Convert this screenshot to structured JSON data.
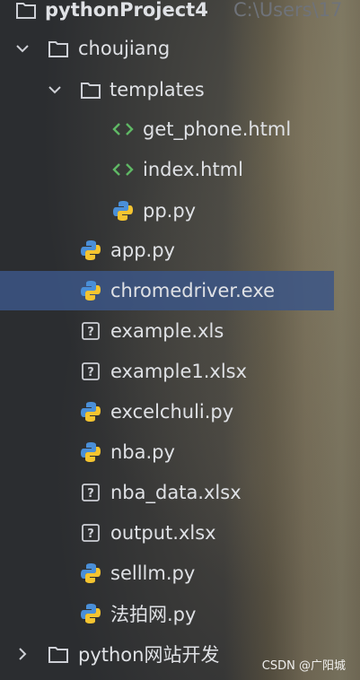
{
  "project": {
    "name": "pythonProject4",
    "path": "C:\\Users\\17"
  },
  "tree": {
    "choujiang": "choujiang",
    "templates": "templates",
    "get_phone": "get_phone.html",
    "index": "index.html",
    "pp": "pp.py",
    "app": "app.py",
    "chromedriver": "chromedriver.exe",
    "example_xls": "example.xls",
    "example1": "example1.xlsx",
    "excelchuli": "excelchuli.py",
    "nba": "nba.py",
    "nba_data": "nba_data.xlsx",
    "output": "output.xlsx",
    "selllm": "selllm.py",
    "fapai": "法拍网.py",
    "pysite": "python网站开发"
  },
  "watermark": "CSDN @广阳城"
}
